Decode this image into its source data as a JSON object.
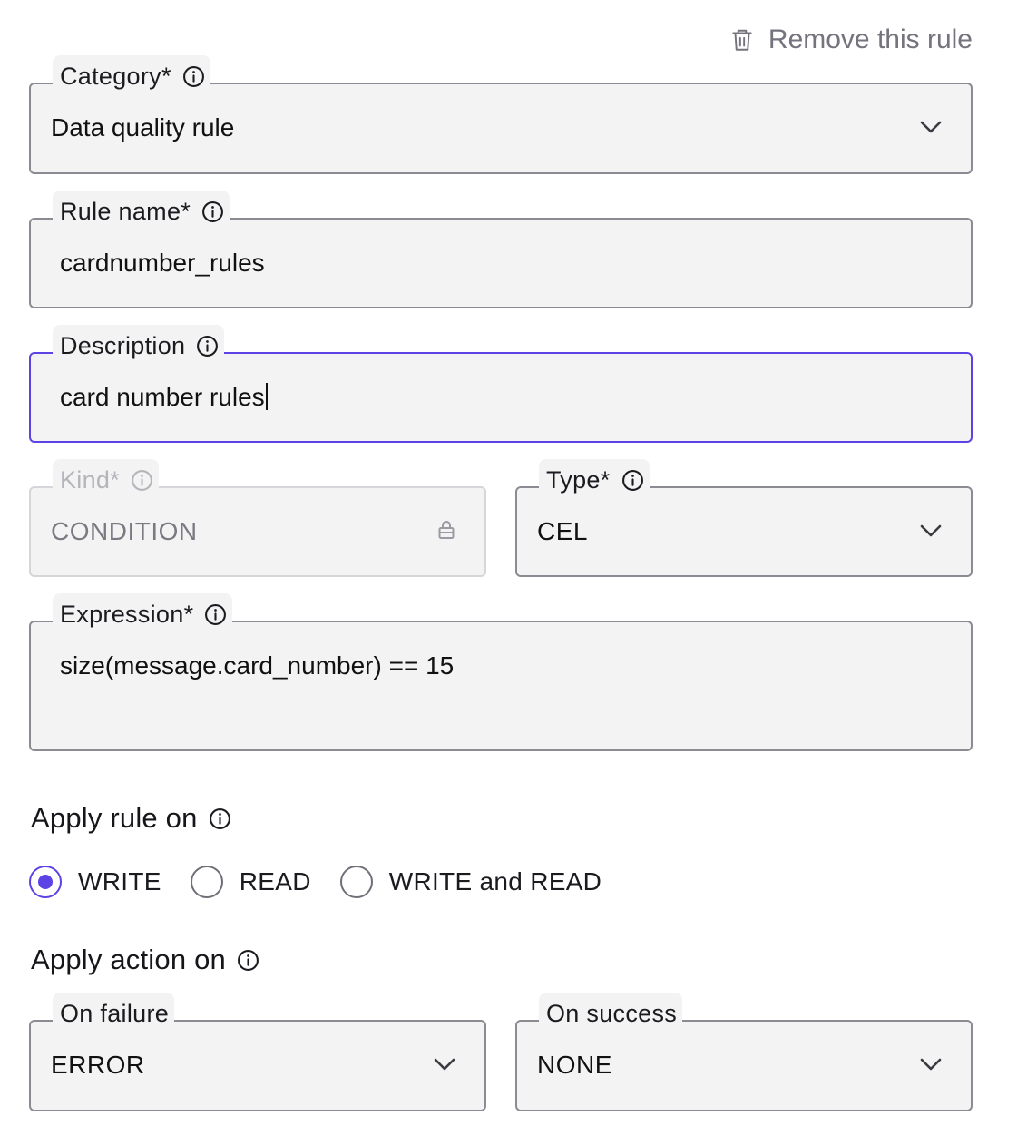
{
  "remove_rule": {
    "label": "Remove this rule",
    "icon": "trash-icon"
  },
  "category": {
    "label": "Category*",
    "value": "Data quality rule"
  },
  "rule_name": {
    "label": "Rule name*",
    "value": "cardnumber_rules"
  },
  "description": {
    "label": "Description",
    "value": "card number rules"
  },
  "kind": {
    "label": "Kind*",
    "value": "CONDITION"
  },
  "type": {
    "label": "Type*",
    "value": "CEL"
  },
  "expression": {
    "label": "Expression*",
    "value": "size(message.card_number) == 15"
  },
  "apply_rule_on": {
    "title": "Apply rule on",
    "options": [
      "WRITE",
      "READ",
      "WRITE and READ"
    ],
    "selected": "WRITE"
  },
  "apply_action_on": {
    "title": "Apply action on",
    "on_failure": {
      "label": "On failure",
      "value": "ERROR"
    },
    "on_success": {
      "label": "On success",
      "value": "NONE"
    }
  },
  "colors": {
    "accent": "#5b43e6",
    "border": "#8b8b93",
    "field_bg": "#f3f3f4",
    "muted_text": "#75737d"
  }
}
